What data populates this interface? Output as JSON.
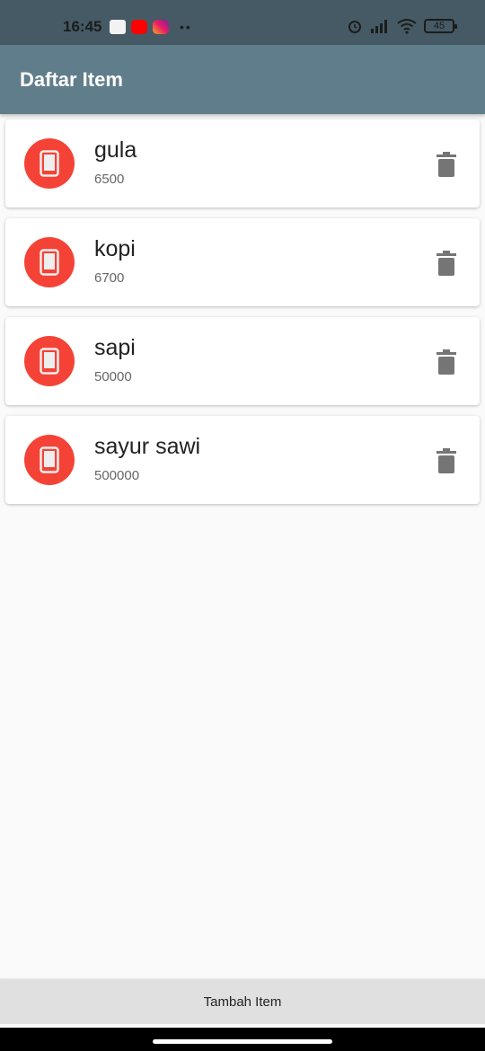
{
  "status_bar": {
    "time": "16:45",
    "notifications": [
      "message-icon",
      "youtube-icon",
      "instagram-icon"
    ],
    "more": "••",
    "battery": "45"
  },
  "app_bar": {
    "title": "Daftar Item"
  },
  "items": [
    {
      "name": "gula",
      "price": "6500"
    },
    {
      "name": "kopi",
      "price": "6700"
    },
    {
      "name": "sapi",
      "price": "50000"
    },
    {
      "name": "sayur sawi",
      "price": "500000"
    }
  ],
  "bottom_button": {
    "label": "Tambah Item"
  },
  "colors": {
    "status_bar": "#455a64",
    "app_bar": "#607d8b",
    "avatar": "#f44336",
    "background": "#fafafa"
  }
}
